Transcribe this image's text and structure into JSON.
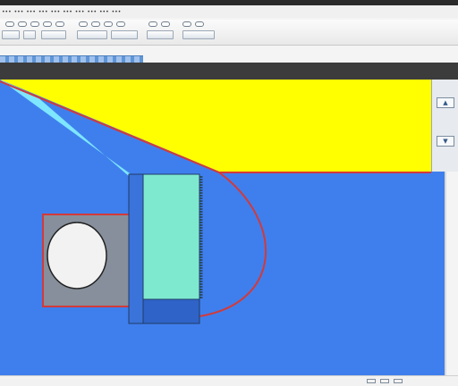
{
  "window": {
    "menu_items": [
      "•••",
      "•••",
      "•••",
      "•••",
      "•••",
      "•••",
      "•••",
      "•••",
      "•••",
      "•••"
    ]
  },
  "toolbar": {
    "buttons": [
      {
        "name": "tool-button-1"
      },
      {
        "name": "tool-button-2"
      },
      {
        "name": "tool-button-3"
      },
      {
        "name": "tool-button-4"
      },
      {
        "name": "tool-button-5"
      },
      {
        "name": "tool-button-6"
      },
      {
        "name": "tool-button-7"
      }
    ]
  },
  "canvas": {
    "background_color": "#3f7fed",
    "yellow_region_color": "#ffff00",
    "cyan_region_color": "#7ee6ff",
    "outline_color": "#d23a3a",
    "panel_color": "#7fe9cf",
    "dark_block_color": "#2f63c8",
    "gray_box_color": "#868f9b",
    "ellipse_color": "#f2f2f2"
  },
  "side_panel": {
    "buttons": [
      "▲",
      "▼"
    ]
  }
}
